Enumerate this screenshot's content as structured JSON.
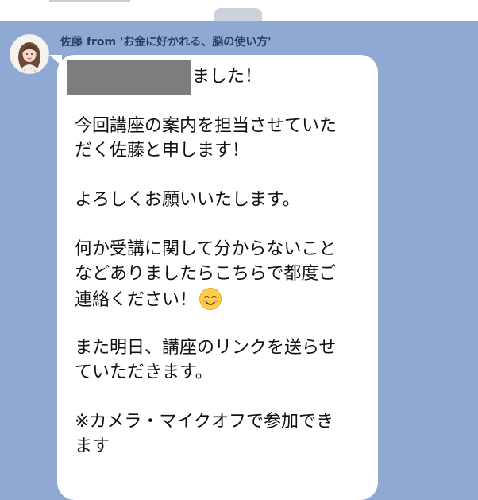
{
  "chat": {
    "sender_name": "佐藤 from 'お金に好かれる、脳の使い方'",
    "message_lines": [
      "ました！",
      "今回講座の案内を担当させていた",
      "だく佐藤と申します！",
      "よろしくお願いいたします。",
      "何か受講に関して分からないこと",
      "などありましたらこちらで都度ご",
      "連絡ください！",
      "また明日、講座のリンクを送らせ",
      "ていただきます。",
      "※カメラ・マイクオフで参加でき",
      "ます"
    ],
    "emoji_icon": "smiling-face-icon"
  },
  "colors": {
    "chat_background": "#8fa9d3",
    "bubble": "#ffffff",
    "redaction": "#7d7d7d",
    "sender_name": "#2a3d5c"
  }
}
